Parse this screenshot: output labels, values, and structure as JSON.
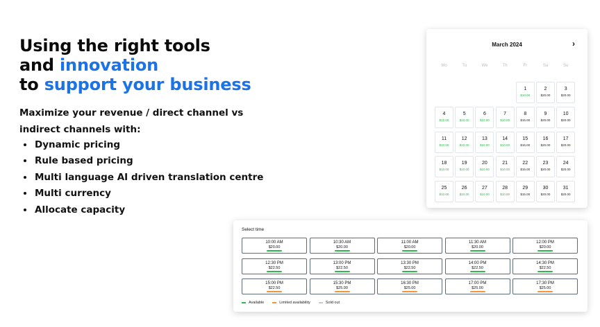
{
  "headline": {
    "line1": "Using the right tools",
    "line2_pre": "and ",
    "line2_accent": "innovation",
    "line3_pre": "to ",
    "line3_accent": "support your business"
  },
  "lead": "Maximize your revenue / direct channel vs indirect channels with:",
  "features": [
    "Dynamic pricing",
    "Rule based pricing",
    "Multi language AI driven translation centre",
    "Multi currency",
    "Allocate capacity"
  ],
  "colors": {
    "accent": "#1a73e8",
    "available": "#2db84b",
    "limited": "#f0953a",
    "sold_out": "#c8c8c8"
  },
  "calendar": {
    "title": "March 2024",
    "next_icon": "chevron-right-icon",
    "next_glyph": "›",
    "weekdays": [
      "Mo",
      "Tu",
      "We",
      "Th",
      "Fr",
      "Sa",
      "Su"
    ],
    "first_weekday_index": 4,
    "days": [
      {
        "day": "1",
        "price": "$10.00",
        "available": true
      },
      {
        "day": "2",
        "price": "$20.00",
        "available": false
      },
      {
        "day": "3",
        "price": "$20.00",
        "available": false
      },
      {
        "day": "4",
        "price": "$10.00",
        "available": true
      },
      {
        "day": "5",
        "price": "$10.00",
        "available": true
      },
      {
        "day": "6",
        "price": "$10.00",
        "available": true
      },
      {
        "day": "7",
        "price": "$10.00",
        "available": true
      },
      {
        "day": "8",
        "price": "$15.00",
        "available": false
      },
      {
        "day": "9",
        "price": "$20.00",
        "available": false
      },
      {
        "day": "10",
        "price": "$20.00",
        "available": false
      },
      {
        "day": "11",
        "price": "$10.00",
        "available": true
      },
      {
        "day": "12",
        "price": "$10.00",
        "available": true
      },
      {
        "day": "13",
        "price": "$10.00",
        "available": true
      },
      {
        "day": "14",
        "price": "$10.00",
        "available": true
      },
      {
        "day": "15",
        "price": "$15.00",
        "available": false
      },
      {
        "day": "16",
        "price": "$20.00",
        "available": false
      },
      {
        "day": "17",
        "price": "$20.00",
        "available": false
      },
      {
        "day": "18",
        "price": "$10.00",
        "available": true
      },
      {
        "day": "19",
        "price": "$10.00",
        "available": true
      },
      {
        "day": "20",
        "price": "$10.00",
        "available": true
      },
      {
        "day": "21",
        "price": "$10.00",
        "available": true
      },
      {
        "day": "22",
        "price": "$15.00",
        "available": false
      },
      {
        "day": "23",
        "price": "$20.00",
        "available": false
      },
      {
        "day": "24",
        "price": "$20.00",
        "available": false
      },
      {
        "day": "25",
        "price": "$10.00",
        "available": true
      },
      {
        "day": "26",
        "price": "$10.00",
        "available": true
      },
      {
        "day": "27",
        "price": "$10.00",
        "available": true
      },
      {
        "day": "28",
        "price": "$10.00",
        "available": true
      },
      {
        "day": "29",
        "price": "$15.00",
        "available": false
      },
      {
        "day": "30",
        "price": "$20.00",
        "available": false
      },
      {
        "day": "31",
        "price": "$20.00",
        "available": false
      }
    ]
  },
  "time_select": {
    "title": "Select time",
    "slots": [
      {
        "time": "10:00 AM",
        "price": "$20.00",
        "status": "available"
      },
      {
        "time": "10:30 AM",
        "price": "$20.00",
        "status": "available"
      },
      {
        "time": "11:00 AM",
        "price": "$20.00",
        "status": "available"
      },
      {
        "time": "11:30 AM",
        "price": "$20.00",
        "status": "available"
      },
      {
        "time": "12:00 PM",
        "price": "$20.00",
        "status": "available"
      },
      {
        "time": "12:30 PM",
        "price": "$22.50",
        "status": "available"
      },
      {
        "time": "13:00 PM",
        "price": "$22.50",
        "status": "available"
      },
      {
        "time": "13:30 PM",
        "price": "$22.50",
        "status": "available"
      },
      {
        "time": "14:00 PM",
        "price": "$22.50",
        "status": "available"
      },
      {
        "time": "14:30 PM",
        "price": "$22.50",
        "status": "available"
      },
      {
        "time": "15:00 PM",
        "price": "$22.50",
        "status": "limited"
      },
      {
        "time": "15:30 PM",
        "price": "$25.00",
        "status": "limited"
      },
      {
        "time": "16:30 PM",
        "price": "$25.00",
        "status": "limited"
      },
      {
        "time": "17:00 PM",
        "price": "$25.00",
        "status": "limited"
      },
      {
        "time": "17:30 PM",
        "price": "$25.00",
        "status": "limited"
      }
    ],
    "legend": [
      {
        "label": "Available",
        "status": "available"
      },
      {
        "label": "Limited availability",
        "status": "limited"
      },
      {
        "label": "Sold out",
        "status": "sold_out"
      }
    ]
  }
}
